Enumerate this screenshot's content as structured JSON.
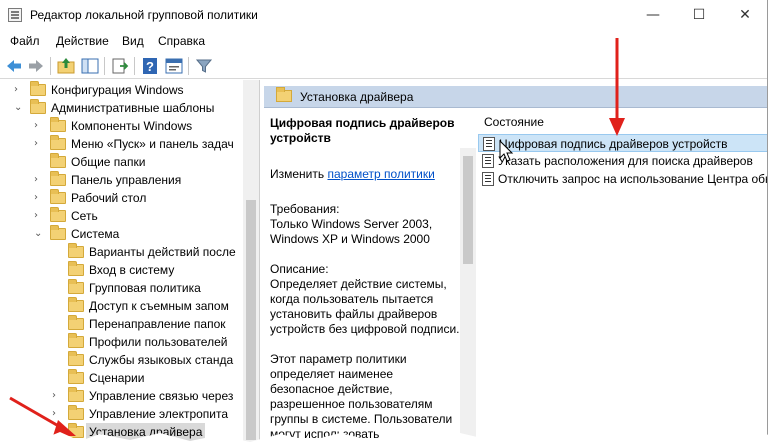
{
  "window": {
    "title": "Редактор локальной групповой политики",
    "minimize": "—",
    "maximize": "☐",
    "close": "✕"
  },
  "menu": {
    "file": "Файл",
    "action": "Действие",
    "view": "Вид",
    "help": "Справка"
  },
  "toolbar": {
    "icons": [
      "back-arrow-icon",
      "forward-arrow-icon",
      "up-folder-icon",
      "show-hide-tree-icon",
      "export-list-icon",
      "help-icon",
      "properties-icon",
      "filter-icon"
    ]
  },
  "tree": {
    "items": [
      {
        "label": "Конфигурация Windows",
        "chevron": "›"
      },
      {
        "label": "Административные шаблоны",
        "chevron": "⌄"
      },
      {
        "label": "Компоненты Windows",
        "chevron": "›"
      },
      {
        "label": "Меню «Пуск» и панель задач",
        "chevron": "›"
      },
      {
        "label": "Общие папки",
        "chevron": ""
      },
      {
        "label": "Панель управления",
        "chevron": "›"
      },
      {
        "label": "Рабочий стол",
        "chevron": "›"
      },
      {
        "label": "Сеть",
        "chevron": "›"
      },
      {
        "label": "Система",
        "chevron": "⌄"
      },
      {
        "label": "Варианты действий после",
        "chevron": ""
      },
      {
        "label": "Вход в систему",
        "chevron": ""
      },
      {
        "label": "Групповая политика",
        "chevron": ""
      },
      {
        "label": "Доступ к съемным запом",
        "chevron": ""
      },
      {
        "label": "Перенаправление папок",
        "chevron": ""
      },
      {
        "label": "Профили пользователей",
        "chevron": ""
      },
      {
        "label": "Службы языковых станда",
        "chevron": ""
      },
      {
        "label": "Сценарии",
        "chevron": ""
      },
      {
        "label": "Управление связью через",
        "chevron": "›"
      },
      {
        "label": "Управление электропита",
        "chevron": "›"
      },
      {
        "label": "Установка драйвера",
        "chevron": ""
      }
    ]
  },
  "pane": {
    "header": "Установка драйвера"
  },
  "description": {
    "title": "Цифровая подпись драйверов устройств",
    "edit_prefix": "Изменить",
    "edit_link": "параметр политики",
    "requirements": "Требования:\nТолько Windows Server 2003, Windows XP и Windows 2000",
    "description": "Описание:\nОпределяет действие системы, когда пользователь пытается установить файлы драйверов устройств без цифровой подписи.",
    "more": "Этот параметр политики определяет наименее безопасное действие, разрешенное пользователям группы в системе. Пользователи могут использовать"
  },
  "settings": {
    "column_header": "Состояние",
    "items": [
      "Цифровая подпись драйверов устройств",
      "Указать расположения для поиска драйверов",
      "Отключить запрос на использование Центра обн"
    ]
  }
}
